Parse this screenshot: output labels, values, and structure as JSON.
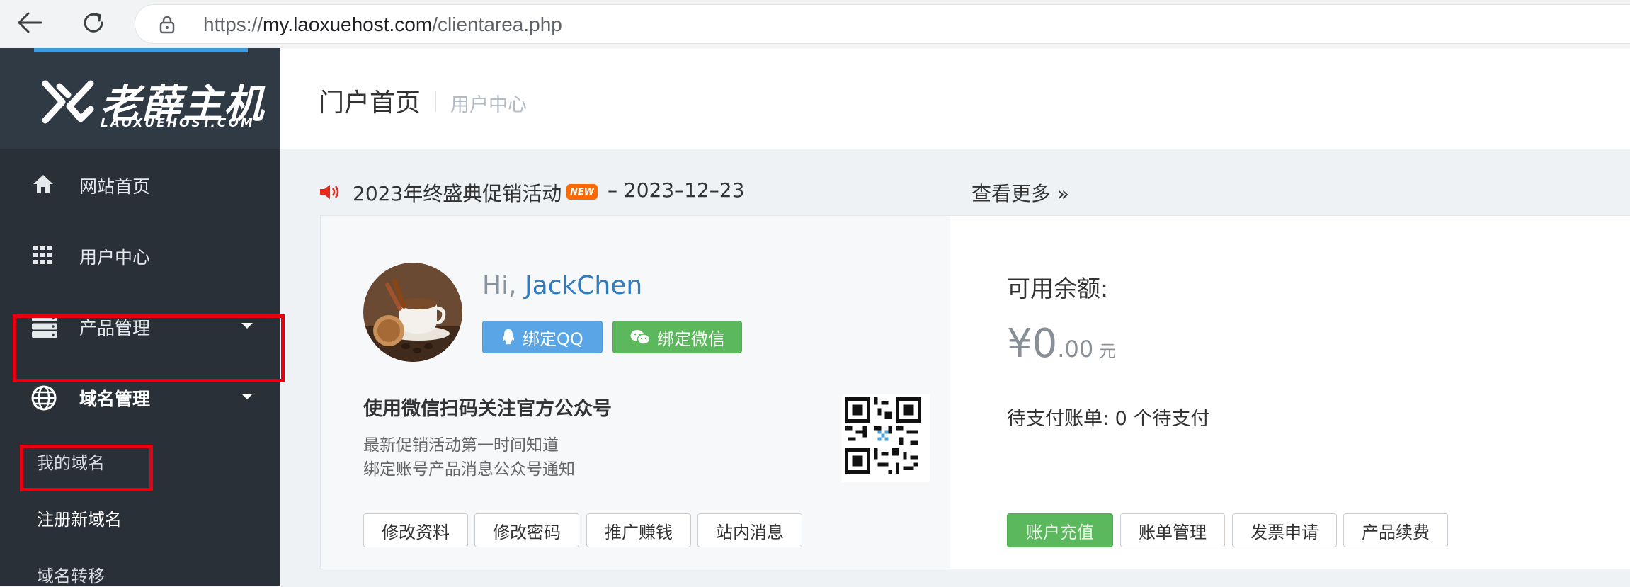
{
  "browser": {
    "url_prefix": "https://",
    "url_domain": "my.laoxuehost.com",
    "url_path": "/clientarea.php"
  },
  "sidebar": {
    "logo_cn": "老薛主机",
    "logo_en": "LAOXUEHOST.COM",
    "items": [
      {
        "label": "网站首页",
        "icon": "home-icon"
      },
      {
        "label": "用户中心",
        "icon": "grid-icon"
      },
      {
        "label": "产品管理",
        "icon": "server-icon",
        "has_dropdown": true
      },
      {
        "label": "域名管理",
        "icon": "globe-icon",
        "has_dropdown": true,
        "highlighted": true
      }
    ],
    "submenu": [
      {
        "label": "我的域名"
      },
      {
        "label": "注册新域名",
        "highlighted": true
      },
      {
        "label": "域名转移"
      }
    ],
    "highlight_color": "#e60012"
  },
  "header": {
    "title": "门户首页",
    "subtitle": "用户中心"
  },
  "promo": {
    "text": "2023年终盛典促销活动",
    "badge": "NEW",
    "date": "–  2023–12–23",
    "more": "查看更多 »"
  },
  "profile": {
    "greeting": "Hi,",
    "username": "JackChen",
    "bind_qq": "绑定QQ",
    "bind_wechat": "绑定微信",
    "follow_title": "使用微信扫码关注官方公众号",
    "follow_line1": "最新促销活动第一时间知道",
    "follow_line2": "绑定账号产品消息公众号通知",
    "buttons": [
      "修改资料",
      "修改密码",
      "推广赚钱",
      "站内消息"
    ]
  },
  "balance": {
    "label": "可用余额:",
    "currency": "¥",
    "integer": "0",
    "decimal": ".00",
    "unit": "元",
    "pending": "待支付账单: 0 个待支付",
    "buttons": [
      "账户充值",
      "账单管理",
      "发票申请",
      "产品续费"
    ]
  },
  "colors": {
    "sidebar_bg": "#293038",
    "accent_blue": "#3b9be0",
    "qq_blue": "#5aa5e6",
    "wechat_green": "#5cb85c",
    "username_blue": "#2f7bbf",
    "new_badge": "#ff6a00"
  }
}
